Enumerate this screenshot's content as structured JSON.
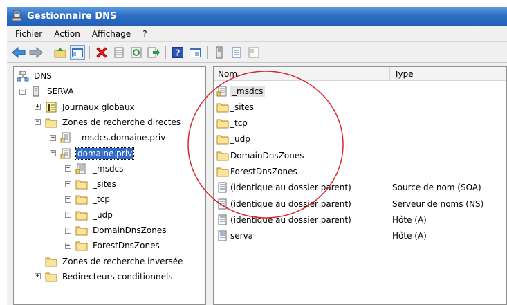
{
  "window": {
    "title": "Gestionnaire DNS"
  },
  "menu": {
    "items": [
      "Fichier",
      "Action",
      "Affichage",
      "?"
    ]
  },
  "toolbar": {
    "buttons": [
      "back-arrow-icon",
      "forward-arrow-icon",
      "up-folder-icon",
      "show-hide-tree-icon",
      "delete-icon",
      "properties-icon",
      "refresh-icon",
      "export-list-icon",
      "help-icon",
      "console-icon",
      "server-icon",
      "list-icon",
      "document-icon"
    ]
  },
  "tree": {
    "items": [
      {
        "label": "DNS",
        "level": 0,
        "expander": "none",
        "icon": "dns-icon"
      },
      {
        "label": "SERVA",
        "level": 0,
        "expander": "−",
        "icon": "server-icon"
      },
      {
        "label": "Journaux globaux",
        "level": 1,
        "expander": "+",
        "icon": "log-icon"
      },
      {
        "label": "Zones de recherche directes",
        "level": 1,
        "expander": "−",
        "icon": "folder-icon"
      },
      {
        "label": "_msdcs.domaine.priv",
        "level": 2,
        "expander": "+",
        "icon": "zone-icon"
      },
      {
        "label": "domaine.priv",
        "level": 2,
        "expander": "−",
        "icon": "zone-icon",
        "selected": true
      },
      {
        "label": "_msdcs",
        "level": 3,
        "expander": "+",
        "icon": "zone-icon"
      },
      {
        "label": "_sites",
        "level": 3,
        "expander": "+",
        "icon": "folder-icon"
      },
      {
        "label": "_tcp",
        "level": 3,
        "expander": "+",
        "icon": "folder-icon"
      },
      {
        "label": "_udp",
        "level": 3,
        "expander": "+",
        "icon": "folder-icon"
      },
      {
        "label": "DomainDnsZones",
        "level": 3,
        "expander": "+",
        "icon": "folder-icon"
      },
      {
        "label": "ForestDnsZones",
        "level": 3,
        "expander": "+",
        "icon": "folder-icon"
      },
      {
        "label": "Zones de recherche inversée",
        "level": 1,
        "expander": "none",
        "icon": "folder-icon"
      },
      {
        "label": "Redirecteurs conditionnels",
        "level": 1,
        "expander": "+",
        "icon": "folder-icon"
      }
    ]
  },
  "list": {
    "columns": [
      "Nom",
      "Type"
    ],
    "rows": [
      {
        "name": "_msdcs",
        "type": "",
        "icon": "zone-icon",
        "selected": true
      },
      {
        "name": "_sites",
        "type": "",
        "icon": "folder-icon"
      },
      {
        "name": "_tcp",
        "type": "",
        "icon": "folder-icon"
      },
      {
        "name": "_udp",
        "type": "",
        "icon": "folder-icon"
      },
      {
        "name": "DomainDnsZones",
        "type": "",
        "icon": "folder-icon"
      },
      {
        "name": "ForestDnsZones",
        "type": "",
        "icon": "folder-icon"
      },
      {
        "name": "(identique au dossier parent)",
        "type": "Source de nom (SOA)",
        "icon": "record-icon"
      },
      {
        "name": "(identique au dossier parent)",
        "type": "Serveur de noms (NS)",
        "icon": "record-icon"
      },
      {
        "name": "(identique au dossier parent)",
        "type": "Hôte (A)",
        "icon": "record-icon"
      },
      {
        "name": "serva",
        "type": "Hôte (A)",
        "icon": "record-icon"
      }
    ]
  },
  "colors": {
    "title_bar": "#2f6fc5",
    "selection": "#3169c6",
    "annotation_circle": "#d9262a"
  }
}
